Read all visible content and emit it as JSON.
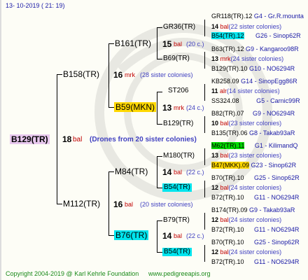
{
  "header": {
    "date": "13- 10-2019 ( 21: 19)"
  },
  "footer": {
    "copyright": "Copyright 2004-2019 @ Karl Kehrle Foundation",
    "site": "www.pedigreeapis.org"
  },
  "root": {
    "id": "B129(TR)",
    "num": "18",
    "suffix": "bal",
    "note": "(Drones from 20 sister colonies)"
  },
  "gen1": [
    {
      "id": "B158(TR)",
      "num": "16",
      "suffix": "mrk",
      "note": "(28 sister colonies)"
    },
    {
      "id": "M112(TR)",
      "num": "16",
      "suffix": "bal",
      "note": "(20 sister colonies)"
    }
  ],
  "gen2": [
    {
      "id": "B161(TR)",
      "num": "15",
      "suffix": "bal",
      "note": "(20 c.)"
    },
    {
      "id": "B59(MKN)",
      "num": "13",
      "suffix": "mrk",
      "note": "(24 c.)"
    },
    {
      "id": "M84(TR)",
      "num": "14",
      "suffix": "bal",
      "note": "(22 c.)"
    },
    {
      "id": "B76(TR)",
      "num": "14",
      "suffix": "bal",
      "note": "(22 c.)"
    }
  ],
  "gen3": [
    {
      "id": "GR36(TR)",
      "num": "14",
      "suffix": "bal",
      "note": "(22 sister colonies)"
    },
    {
      "id": "B69(TR)",
      "num": "13",
      "suffix": "mrk",
      "note": "(24 sister colonies)"
    },
    {
      "id": "ST206",
      "num": "11",
      "suffix": "alr",
      "note": "(14 sister colonies)"
    },
    {
      "id": "B129(TR)",
      "num": "10",
      "suffix": "bal",
      "note": "(23 sister colonies)"
    },
    {
      "id": "M180(TR)",
      "num": "13",
      "suffix": "bal",
      "note": "(23 sister colonies)"
    },
    {
      "id": "B54(TR)",
      "num": "12",
      "suffix": "bal",
      "note": "(24 sister colonies)"
    },
    {
      "id": "B79(TR)",
      "num": "12",
      "suffix": "bal",
      "note": "(24 sister colonies)"
    },
    {
      "id": "B54(TR)",
      "num": "12",
      "suffix": "bal",
      "note": "(24 sister colonies)"
    }
  ],
  "gen4": [
    {
      "id": "GR118(TR).12",
      "ref": "G4 - Gr.R.mounta"
    },
    {
      "id": "B54(TR).12",
      "ref": "G26 - Sinop62R"
    },
    {
      "id": "B63(TR).12",
      "ref": "G9 - Kangaroo98R"
    },
    {
      "id": "B129(TR).10",
      "ref": "G10 - NO6294R"
    },
    {
      "id": "KB258.09",
      "ref": "G14 - SinopEgg86R"
    },
    {
      "id": "SS324.08",
      "ref": "G5 - Carnic99R"
    },
    {
      "id": "B82(TR).07",
      "ref": "G9 - NO6294R"
    },
    {
      "id": "B135(TR).06",
      "ref": "G8 - Takab93aR"
    },
    {
      "id": "M62(TR).11",
      "ref": "G1 - KilimandQ"
    },
    {
      "id": "B47(MKK).09",
      "ref": "G23 - Sinop62R"
    },
    {
      "id": "B70(TR).10",
      "ref": "G25 - Sinop62R"
    },
    {
      "id": "B72(TR).10",
      "ref": "G11 - NO6294R"
    },
    {
      "id": "B174(TR).09",
      "ref": "G9 - Takab93aR"
    },
    {
      "id": "B72(TR).10",
      "ref": "G11 - NO6294R"
    },
    {
      "id": "B70(TR).10",
      "ref": "G25 - Sinop62R"
    },
    {
      "id": "B72(TR).10",
      "ref": "G11 - NO6294R"
    }
  ]
}
